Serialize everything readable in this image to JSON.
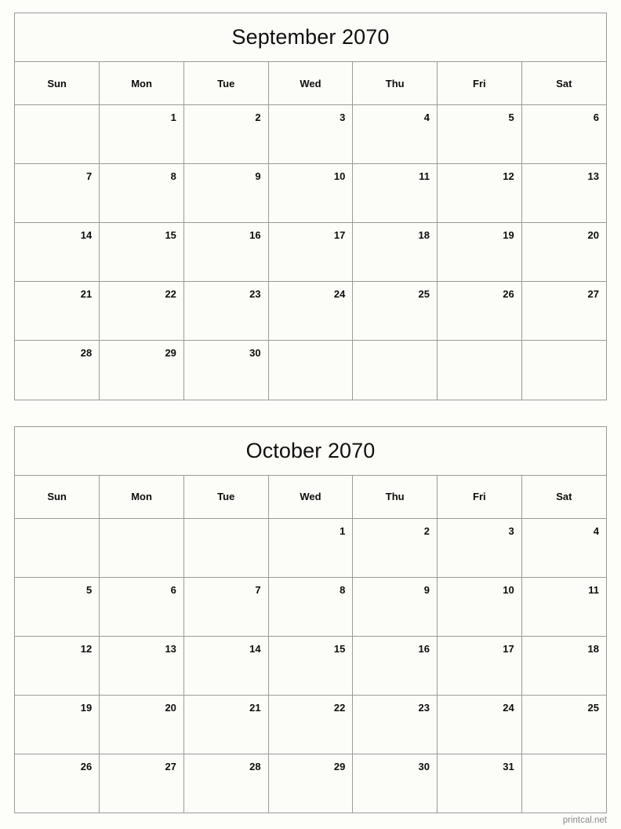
{
  "page": {
    "background_color": "#fdfdfa",
    "cell_background_color": "#fcfdf8",
    "border_color": "#9a9a9a",
    "text_color": "#0d0d0d",
    "footer_color": "#8b8b8b"
  },
  "footer": {
    "text": "printcal.net"
  },
  "weekday_headers": [
    "Sun",
    "Mon",
    "Tue",
    "Wed",
    "Thu",
    "Fri",
    "Sat"
  ],
  "months": [
    {
      "title": "September 2070",
      "month_name": "September",
      "year": "2070",
      "weeks": [
        [
          "",
          "1",
          "2",
          "3",
          "4",
          "5",
          "6"
        ],
        [
          "7",
          "8",
          "9",
          "10",
          "11",
          "12",
          "13"
        ],
        [
          "14",
          "15",
          "16",
          "17",
          "18",
          "19",
          "20"
        ],
        [
          "21",
          "22",
          "23",
          "24",
          "25",
          "26",
          "27"
        ],
        [
          "28",
          "29",
          "30",
          "",
          "",
          "",
          ""
        ]
      ]
    },
    {
      "title": "October 2070",
      "month_name": "October",
      "year": "2070",
      "weeks": [
        [
          "",
          "",
          "",
          "1",
          "2",
          "3",
          "4"
        ],
        [
          "5",
          "6",
          "7",
          "8",
          "9",
          "10",
          "11"
        ],
        [
          "12",
          "13",
          "14",
          "15",
          "16",
          "17",
          "18"
        ],
        [
          "19",
          "20",
          "21",
          "22",
          "23",
          "24",
          "25"
        ],
        [
          "26",
          "27",
          "28",
          "29",
          "30",
          "31",
          ""
        ]
      ]
    }
  ]
}
